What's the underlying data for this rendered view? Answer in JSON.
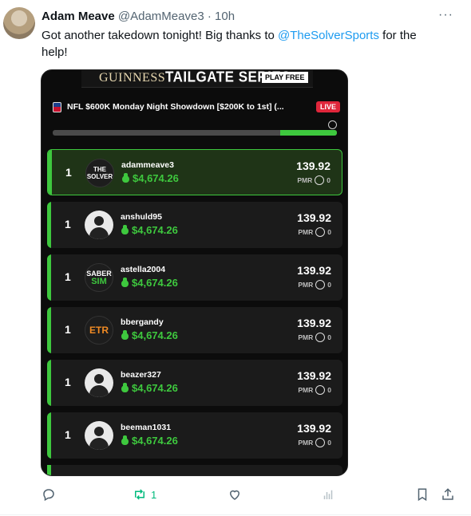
{
  "tweet": {
    "author_name": "Adam Meave",
    "handle": "@AdamMeave3",
    "separator": "·",
    "time": "10h",
    "more_icon": "more-icon",
    "text_before": "Got another takedown tonight! Big thanks to ",
    "mention": "@TheSolverSports",
    "text_after": " for the help!"
  },
  "media": {
    "banner": {
      "brand": "GUINNESS",
      "series": "TAILGATE SERIES",
      "cta": "PLAY FREE"
    },
    "contest": {
      "title": "NFL $600K Monday Night Showdown [$200K to 1st] (...",
      "live_badge": "LIVE"
    },
    "progress_fraction": 0.2,
    "rows": [
      {
        "rank": "1",
        "username": "adammeave3",
        "prize": "$4,674.26",
        "score": "139.92",
        "pmr_label": "PMR",
        "pmr_value": "0",
        "avatar": "thesolver-logo",
        "avatar_text": "THE SOLVER"
      },
      {
        "rank": "1",
        "username": "anshuld95",
        "prize": "$4,674.26",
        "score": "139.92",
        "pmr_label": "PMR",
        "pmr_value": "0",
        "avatar": "default-avatar"
      },
      {
        "rank": "1",
        "username": "astella2004",
        "prize": "$4,674.26",
        "score": "139.92",
        "pmr_label": "PMR",
        "pmr_value": "0",
        "avatar": "sabersim-logo",
        "avatar_text_1": "SABER",
        "avatar_text_2": "SIM"
      },
      {
        "rank": "1",
        "username": "bbergandy",
        "prize": "$4,674.26",
        "score": "139.92",
        "pmr_label": "PMR",
        "pmr_value": "0",
        "avatar": "etr-logo",
        "avatar_text": "ETR"
      },
      {
        "rank": "1",
        "username": "beazer327",
        "prize": "$4,674.26",
        "score": "139.92",
        "pmr_label": "PMR",
        "pmr_value": "0",
        "avatar": "default-avatar"
      },
      {
        "rank": "1",
        "username": "beeman1031",
        "prize": "$4,674.26",
        "score": "139.92",
        "pmr_label": "PMR",
        "pmr_value": "0",
        "avatar": "default-avatar"
      }
    ]
  },
  "actions": {
    "reply_icon": "reply-icon",
    "retweet_icon": "retweet-icon",
    "retweet_count": "1",
    "like_icon": "heart-icon",
    "views_icon": "analytics-icon",
    "bookmark_icon": "bookmark-icon",
    "share_icon": "share-icon"
  },
  "colors": {
    "accent_green": "#3ec83e",
    "live_red": "#e0263b",
    "mention_blue": "#1d9bf0",
    "retweet_green": "#00ba7c"
  }
}
